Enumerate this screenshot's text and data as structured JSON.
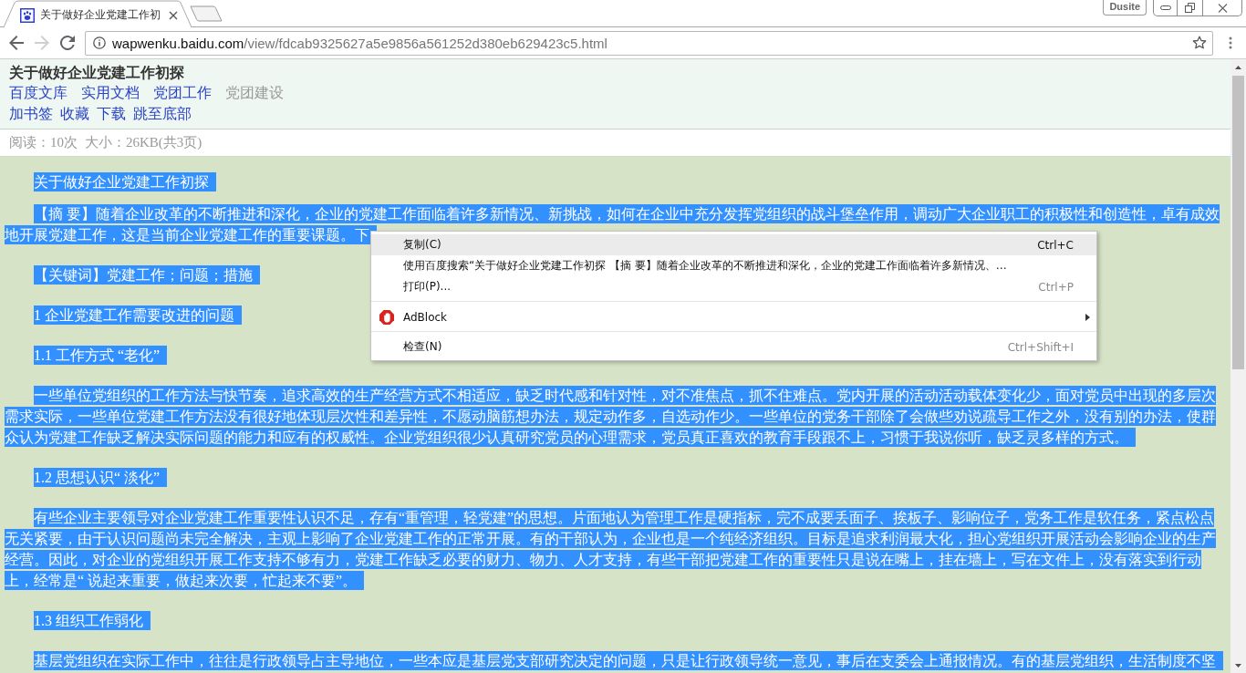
{
  "browser": {
    "tab": {
      "title": "关于做好企业党建工作初",
      "selected": true
    },
    "frame_button": "Dusite",
    "nav_buttons": [
      {
        "kind": "back",
        "disabled": false
      },
      {
        "kind": "forward",
        "disabled": true
      },
      {
        "kind": "reload",
        "disabled": false
      }
    ],
    "address": {
      "host": "wapwenku.baidu.com",
      "path": "/view/fdcab9325627a5e9856a561252d380eb629423c5.html"
    }
  },
  "header": {
    "title": "关于做好企业党建工作初探",
    "breadcrumbs": [
      {
        "label": "百度文库",
        "current": false
      },
      {
        "label": "实用文档",
        "current": false
      },
      {
        "label": "党团工作",
        "current": false
      },
      {
        "label": "党团建设",
        "current": true
      }
    ],
    "actions": [
      "加书签",
      "收藏",
      "下载",
      "跳至底部"
    ]
  },
  "stats": [
    "阅读：10次",
    "大小：26KB(共3页)"
  ],
  "document": {
    "paragraphs": [
      {
        "text": "关于做好企业党建工作初探",
        "selected": true
      },
      {
        "text": "【摘 要】随着企业改革的不断推进和深化，企业的党建工作面临着许多新情况、新挑战，如何在企业中充分发挥党组织的战斗堡垒作用，调动广大企业职工的积极性和创造性，卓有成效地开展党建工作，这是当前企业党建工作的重要课题。下",
        "selected": true
      },
      {
        "text": "【关键词】党建工作；问题；措施",
        "selected": true
      },
      {
        "text": "1 企业党建工作需要改进的问题",
        "selected": true
      },
      {
        "text": "1.1 工作方式 “老化”",
        "selected": true
      },
      {
        "text": "一些单位党组织的工作方法与快节奏，追求高效的生产经营方式不相适应，缺乏时代感和针对性，对不准焦点，抓不住难点。党内开展的活动活动载体变化少，面对党员中出现的多层次需求实际，一些单位党建工作方法没有很好地体现层次性和差异性，不愿动脑筋想办法，规定动作多，自选动作少。一些单位的党务干部除了会做些劝说疏导工作之外，没有别的办法，使群众认为党建工作缺乏解决实际问题的能力和应有的权威性。企业党组织很少认真研究党员的心理需求，党员真正喜欢的教育手段跟不上，习惯于我说你听，缺乏灵多样的方式。",
        "selected": true
      },
      {
        "text": "1.2 思想认识“ 淡化”",
        "selected": true
      },
      {
        "text": "有些企业主要领导对企业党建工作重要性认识不足，存有“重管理，轻党建”的思想。片面地认为管理工作是硬指标，完不成要丢面子、挨板子、影响位子，党务工作是软任务，紧点松点无关紧要，由于认识问题尚未完全解决，主观上影响了企业党建工作的正常开展。有的干部认为，企业也是一个纯经济组织。目标是追求利润最大化，担心党组织开展活动会影响企业的生产经营。因此，对企业的党组织开展工作支持不够有力，党建工作缺乏必要的财力、物力、人才支持，有些干部把党建工作的重要性只是说在嘴上，挂在墙上，写在文件上，没有落实到行动上，经常是“ 说起来重要，做起来次要，忙起来不要”。",
        "selected": true
      },
      {
        "text": "1.3 组织工作弱化",
        "selected": true
      },
      {
        "text": "基层党组织在实际工作中，往往是行政领导占主导地位，一些本应是基层党支部研究决定的问题，只是让行政领导统一意见，事后在支委会上通报情况。有的基层党组织，生活制度不坚",
        "selected": true
      }
    ]
  },
  "context_menu": {
    "groups": [
      {
        "items": [
          {
            "kind": "command",
            "label": "复制(C)",
            "shortcut": "Ctrl+C",
            "selected": true
          },
          {
            "kind": "command",
            "label": "使用百度搜索“关于做好企业党建工作初探 【摘 要】随着企业改革的不断推进和深化，企业的党建工作面临着许多新情况、…",
            "selected": false
          },
          {
            "kind": "command",
            "label": "打印(P)...",
            "shortcut": "Ctrl+P",
            "selected": false
          }
        ]
      },
      {
        "items": [
          {
            "kind": "extension",
            "label": "AdBlock",
            "selected": false
          }
        ]
      },
      {
        "items": [
          {
            "kind": "command",
            "label": "检查(N)",
            "shortcut": "Ctrl+Shift+I",
            "selected": false
          }
        ]
      }
    ]
  }
}
